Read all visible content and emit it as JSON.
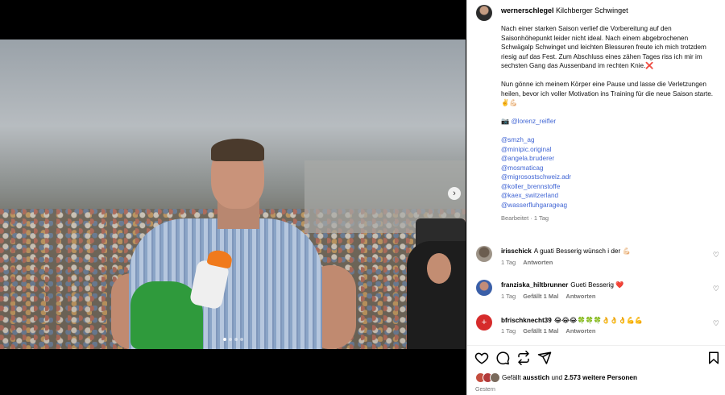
{
  "post": {
    "username": "wernerschlegel",
    "location": "Kilchberger Schwinget",
    "caption_p1": "Nach einer starken Saison verlief die Vorbereitung auf den Saisonhöhepunkt leider nicht ideal. Nach einem abgebrochenen Schwägalp Schwinget und leichten Blessuren freute ich mich trotzdem riesig auf das Fest. Zum Abschluss eines zähen Tages riss ich mir im sechsten Gang das Aussenband im rechten Knie.❌",
    "caption_p2": "Nun gönne ich meinem Körper eine Pause und lasse die Verletzungen heilen, bevor ich voller Motivation ins Training für die neue Saison starte. ✌️💪🏻",
    "video_credit": "📷 @lorenz_reifler",
    "mentions": [
      "@smzh_ag",
      "@minipic.original",
      "@angela.bruderer",
      "@mosmaticag",
      "@migrosostschweiz.adr",
      "@koller_brennstoffe",
      "@kaex_switzerland",
      "@wasserfluhgarageag"
    ],
    "edited_meta": "Bearbeitet · 1 Tag",
    "carousel_dots": 4
  },
  "comments": [
    {
      "username": "irisschick",
      "text": "A guati Besserig wünsch i der 💪🏻",
      "time": "1 Tag",
      "likes": "",
      "reply": "Antworten"
    },
    {
      "username": "franziska_hiltbrunner",
      "text": "Gueti Besserig ❤️",
      "time": "1 Tag",
      "likes": "Gefällt 1 Mal",
      "reply": "Antworten"
    },
    {
      "username": "bfrischknecht39",
      "text": "😂😂😂🍀🍀🍀👌👌👌💪💪",
      "time": "1 Tag",
      "likes": "Gefällt 1 Mal",
      "reply": "Antworten"
    }
  ],
  "likes": {
    "prefix": "Gefällt",
    "user": "ausstich",
    "mid": "und",
    "count": "2.573 weitere Personen"
  },
  "date": "Gestern",
  "icons": [
    "heart-icon",
    "comment-icon",
    "share-icon",
    "send-icon",
    "bookmark-icon",
    "chevron-right-icon"
  ],
  "colors": {
    "link": "#4065d4",
    "muted": "#737373",
    "like_heart": "#ff3040"
  }
}
